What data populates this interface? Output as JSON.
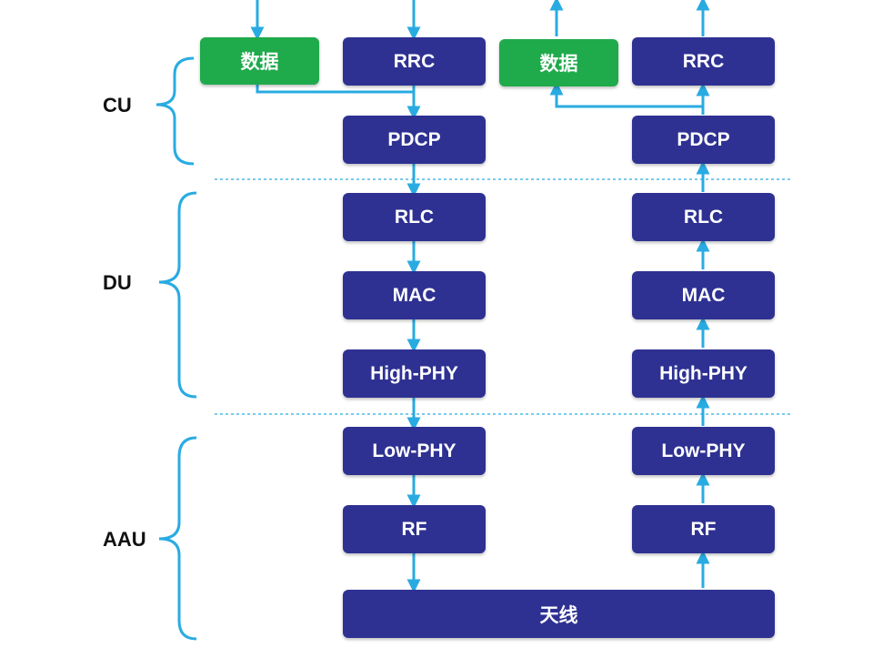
{
  "zones": {
    "cu": "CU",
    "du": "DU",
    "aau": "AAU"
  },
  "downlink": {
    "data": "数据",
    "rrc": "RRC",
    "pdcp": "PDCP",
    "rlc": "RLC",
    "mac": "MAC",
    "high_phy": "High-PHY",
    "low_phy": "Low-PHY",
    "rf": "RF"
  },
  "uplink": {
    "data": "数据",
    "rrc": "RRC",
    "pdcp": "PDCP",
    "rlc": "RLC",
    "mac": "MAC",
    "high_phy": "High-PHY",
    "low_phy": "Low-PHY",
    "rf": "RF"
  },
  "antenna": "天线",
  "colors": {
    "layer_box": "#2e3192",
    "data_box": "#1faa4b",
    "arrow": "#29abe2",
    "brace": "#29abe2",
    "divider": "#29abe2"
  }
}
